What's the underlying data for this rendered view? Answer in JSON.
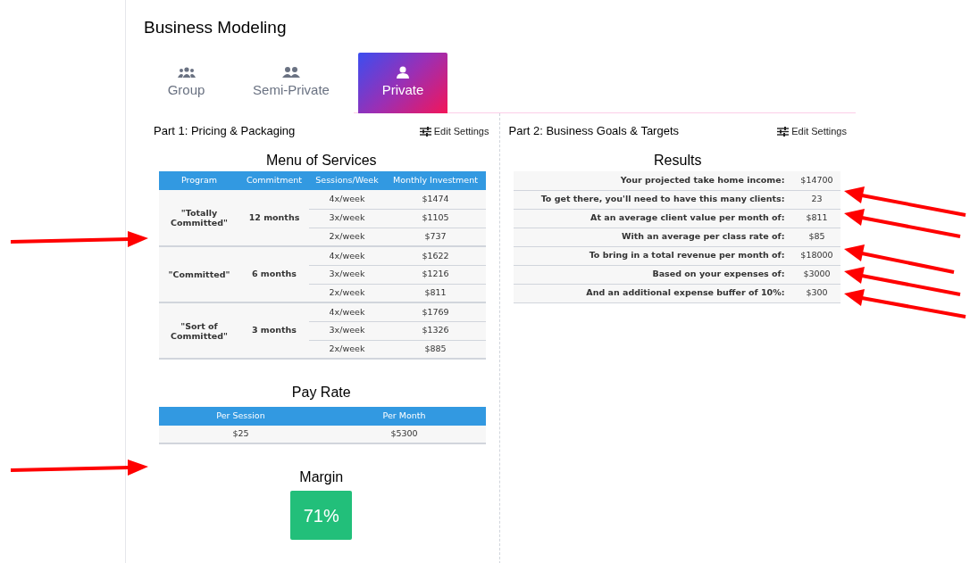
{
  "title": "Business Modeling",
  "tabs": [
    {
      "label": "Group",
      "kind": "group",
      "selected": false
    },
    {
      "label": "Semi-Private",
      "kind": "pair",
      "selected": false
    },
    {
      "label": "Private",
      "kind": "single",
      "selected": true
    }
  ],
  "part1": {
    "heading": "Part 1: Pricing & Packaging",
    "edit_settings": "Edit Settings",
    "menu": {
      "title": "Menu of Services",
      "columns": [
        "Program",
        "Commitment",
        "Sessions/Week",
        "Monthly Investment"
      ],
      "groups": [
        {
          "program": "\"Totally Committed\"",
          "commitment": "12 months",
          "options": [
            {
              "sessions": "4x/week",
              "price": "$1474"
            },
            {
              "sessions": "3x/week",
              "price": "$1105"
            },
            {
              "sessions": "2x/week",
              "price": "$737"
            }
          ]
        },
        {
          "program": "\"Committed\"",
          "commitment": "6 months",
          "options": [
            {
              "sessions": "4x/week",
              "price": "$1622"
            },
            {
              "sessions": "3x/week",
              "price": "$1216"
            },
            {
              "sessions": "2x/week",
              "price": "$811"
            }
          ]
        },
        {
          "program": "\"Sort of Committed\"",
          "commitment": "3 months",
          "options": [
            {
              "sessions": "4x/week",
              "price": "$1769"
            },
            {
              "sessions": "3x/week",
              "price": "$1326"
            },
            {
              "sessions": "2x/week",
              "price": "$885"
            }
          ]
        }
      ]
    },
    "pay_rate": {
      "title": "Pay Rate",
      "columns": [
        "Per Session",
        "Per Month"
      ],
      "rows": [
        [
          "$25",
          "$5300"
        ]
      ]
    },
    "margin": {
      "title": "Margin",
      "value": "71%"
    }
  },
  "part2": {
    "heading": "Part 2: Business Goals & Targets",
    "edit_settings": "Edit Settings",
    "results": {
      "title": "Results",
      "rows": [
        {
          "label": "Your projected take home income:",
          "value": "$14700"
        },
        {
          "label": "To get there, you'll need to have this many clients:",
          "value": "23"
        },
        {
          "label": "At an average client value per month of:",
          "value": "$811"
        },
        {
          "label": "With an average per class rate of:",
          "value": "$85"
        },
        {
          "label": "To bring in a total revenue per month of:",
          "value": "$18000"
        },
        {
          "label": "Based on your expenses of:",
          "value": "$3000"
        },
        {
          "label": "And an additional expense buffer of 10%:",
          "value": "$300"
        }
      ]
    }
  }
}
